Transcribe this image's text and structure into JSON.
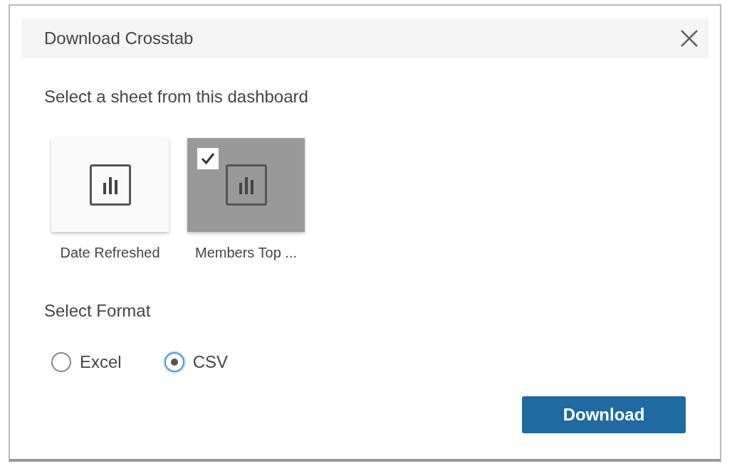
{
  "dialog": {
    "title": "Download Crosstab"
  },
  "sheet_prompt": "Select a sheet from this dashboard",
  "sheets": [
    {
      "label": "Date Refreshed",
      "selected": false
    },
    {
      "label": "Members Top ...",
      "selected": true
    }
  ],
  "format_prompt": "Select Format",
  "formats": [
    {
      "label": "Excel",
      "selected": false
    },
    {
      "label": "CSV",
      "selected": true
    }
  ],
  "primary_button": "Download"
}
